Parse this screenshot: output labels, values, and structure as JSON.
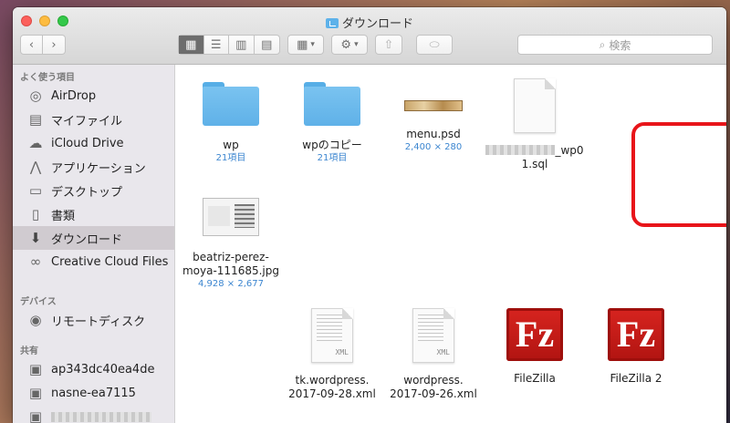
{
  "window": {
    "title": "ダウンロード"
  },
  "toolbar": {
    "view_icon": "▦"
  },
  "search": {
    "placeholder": "検索"
  },
  "sidebar": {
    "sections": [
      {
        "title": "よく使う項目",
        "items": [
          {
            "label": "AirDrop",
            "icon": "airdrop-icon"
          },
          {
            "label": "マイファイル",
            "icon": "my-files-icon"
          },
          {
            "label": "iCloud Drive",
            "icon": "cloud-icon"
          },
          {
            "label": "アプリケーション",
            "icon": "applications-icon"
          },
          {
            "label": "デスクトップ",
            "icon": "desktop-icon"
          },
          {
            "label": "書類",
            "icon": "documents-icon"
          },
          {
            "label": "ダウンロード",
            "icon": "download-icon",
            "selected": true
          },
          {
            "label": "Creative Cloud Files",
            "icon": "creative-cloud-icon"
          }
        ]
      },
      {
        "title": "デバイス",
        "items": [
          {
            "label": "リモートディスク",
            "icon": "disc-icon"
          }
        ]
      },
      {
        "title": "共有",
        "items": [
          {
            "label": "ap343dc40ea4de",
            "icon": "computer-icon"
          },
          {
            "label": "nasne-ea7115",
            "icon": "computer-icon"
          }
        ]
      }
    ]
  },
  "files": [
    {
      "name": "wp",
      "sub": "21項目",
      "kind": "folder"
    },
    {
      "name": "wpのコピー",
      "sub": "21項目",
      "kind": "folder"
    },
    {
      "name": "menu.psd",
      "sub": "2,400 × 280",
      "kind": "image"
    },
    {
      "name_suffix": "_wp0",
      "name_line2": "1.sql",
      "kind": "doc",
      "highlighted": true
    },
    {
      "name": "beatriz-perez-",
      "name_line2": "moya-111685.jpg",
      "sub": "4,928 × 2,677",
      "kind": "image"
    },
    {
      "name": "tk.wordpress.",
      "name_line2": "2017-09-28.xml",
      "kind": "xml",
      "tag": "XML"
    },
    {
      "name": "wordpress.",
      "name_line2": "2017-09-26.xml",
      "kind": "xml",
      "tag": "XML"
    },
    {
      "name": "FileZilla",
      "kind": "app",
      "badge": "Fz"
    },
    {
      "name": "FileZilla 2",
      "kind": "app",
      "badge": "Fz"
    }
  ]
}
